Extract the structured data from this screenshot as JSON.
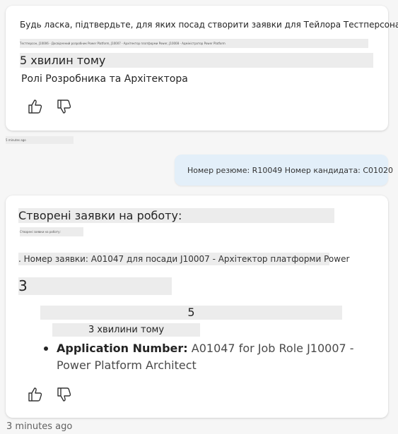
{
  "card1": {
    "question": "Будь ласка, підтвердьте, для яких посад створити заявки для Тейлора Тестперсона.",
    "tiny_line": "Тестперсон, J10006 - Досвідчений розробник Power Platform, J10007 - Архітектор платформи Power, J10008 - Адміністратор Power Platform",
    "time_ago": "5 хвилин тому",
    "answer": "Ролі Розробника та Архітектора",
    "like_icon": "thumbs-up-icon",
    "dislike_icon": "thumbs-down-icon"
  },
  "meta1": "5 minutes ago",
  "user_message": "Номер резюме: R10049 Номер кандидата: C01020",
  "card2": {
    "title": "Створені заявки на роботу:",
    "tiny_line": "Створені заявки на роботу:",
    "item_line": ". Номер заявки: A01047 для посади J10007 - Архітектор платформи Power",
    "big_number": "3",
    "mid_number": "5",
    "time_ago": "3 хвилини тому",
    "bullet_label": "Application Number:",
    "bullet_text": " A01047 for Job Role J10007 -",
    "bullet_text2": "Power Platform Architect",
    "like_icon": "thumbs-up-icon",
    "dislike_icon": "thumbs-down-icon"
  },
  "footer_time": "3 minutes ago"
}
